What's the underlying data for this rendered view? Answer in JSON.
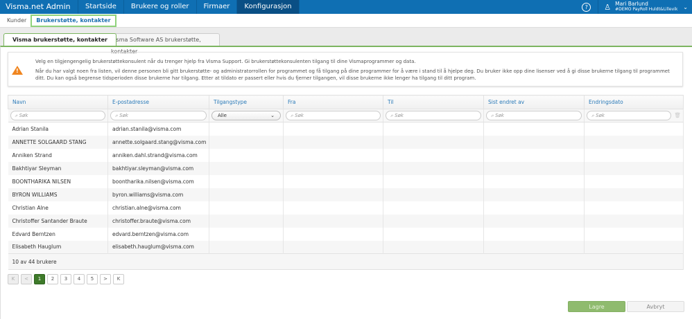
{
  "nav": {
    "brand": "Visma.net Admin",
    "items": [
      "Startside",
      "Brukere og roller",
      "Firmaer",
      "Konfigurasjon"
    ],
    "active": "Konfigurasjon",
    "user_name": "Mari Barlund",
    "user_company": "#DEMO PayRoll Huldt&Lillevik"
  },
  "subnav": [
    "Kunder",
    "Brukerstøtte, kontakter"
  ],
  "tabs": [
    "Visma brukerstøtte, kontakter",
    "Visma Software AS brukerstøtte, kontakter"
  ],
  "info": {
    "p1": "Velg en tilgjengengelig brukerstøttekonsulent når du trenger hjelp fra Visma Support. Gi brukerstøttekonsulenten tilgang til dine Vismaprogrammer og data.",
    "p2": "Når du har valgt noen fra listen, vil denne personen bli gitt brukerstøtte- og administratorrollen for programmet og få tilgang på dine programmer for å være i stand til å hjelpe deg. Du bruker ikke opp dine lisenser ved å gi disse brukerne tilgang til programmet ditt. Du kan også begrense tidsperioden disse brukerne har tilgang. Etter at tildato er passert eller hvis du fjerner tilgangen, vil disse brukerne ikke lenger ha tilgang til ditt program."
  },
  "table": {
    "columns": [
      "Navn",
      "E-postadresse",
      "Tilgangstype",
      "Fra",
      "Til",
      "Sist endret av",
      "Endringsdato"
    ],
    "search_placeholder": "Søk",
    "access_filter": "Alle",
    "rows": [
      [
        "Adrian Stanila",
        "adrian.stanila@visma.com"
      ],
      [
        "ANNETTE SOLGAARD STANG",
        "annette.solgaard.stang@visma.com"
      ],
      [
        "Anniken Strand",
        "anniken.dahl.strand@visma.com"
      ],
      [
        "Bakhtiyar Sleyman",
        "bakhtiyar.sleyman@visma.com"
      ],
      [
        "BOONTHARIKA NILSEN",
        "boontharika.nilsen@visma.com"
      ],
      [
        "BYRON WILLIAMS",
        "byron.williams@visma.com"
      ],
      [
        "Christian Alne",
        "christian.alne@visma.com"
      ],
      [
        "Christoffer Santander Braute",
        "christoffer.braute@visma.com"
      ],
      [
        "Edvard Berntzen",
        "edvard.berntzen@visma.com"
      ],
      [
        "Elisabeth Hauglum",
        "elisabeth.hauglum@visma.com"
      ]
    ],
    "count": "10 av 44 brukere"
  },
  "pager": {
    "pages": [
      "1",
      "2",
      "3",
      "4",
      "5"
    ],
    "current": "1",
    "first": "K",
    "prev": "<",
    "next": ">",
    "last": "K"
  },
  "buttons": {
    "save": "Lagre",
    "cancel": "Avbryt"
  },
  "colors": {
    "nav": "#0f6fb3",
    "accent": "#7cb560",
    "warning": "#f0851f"
  }
}
